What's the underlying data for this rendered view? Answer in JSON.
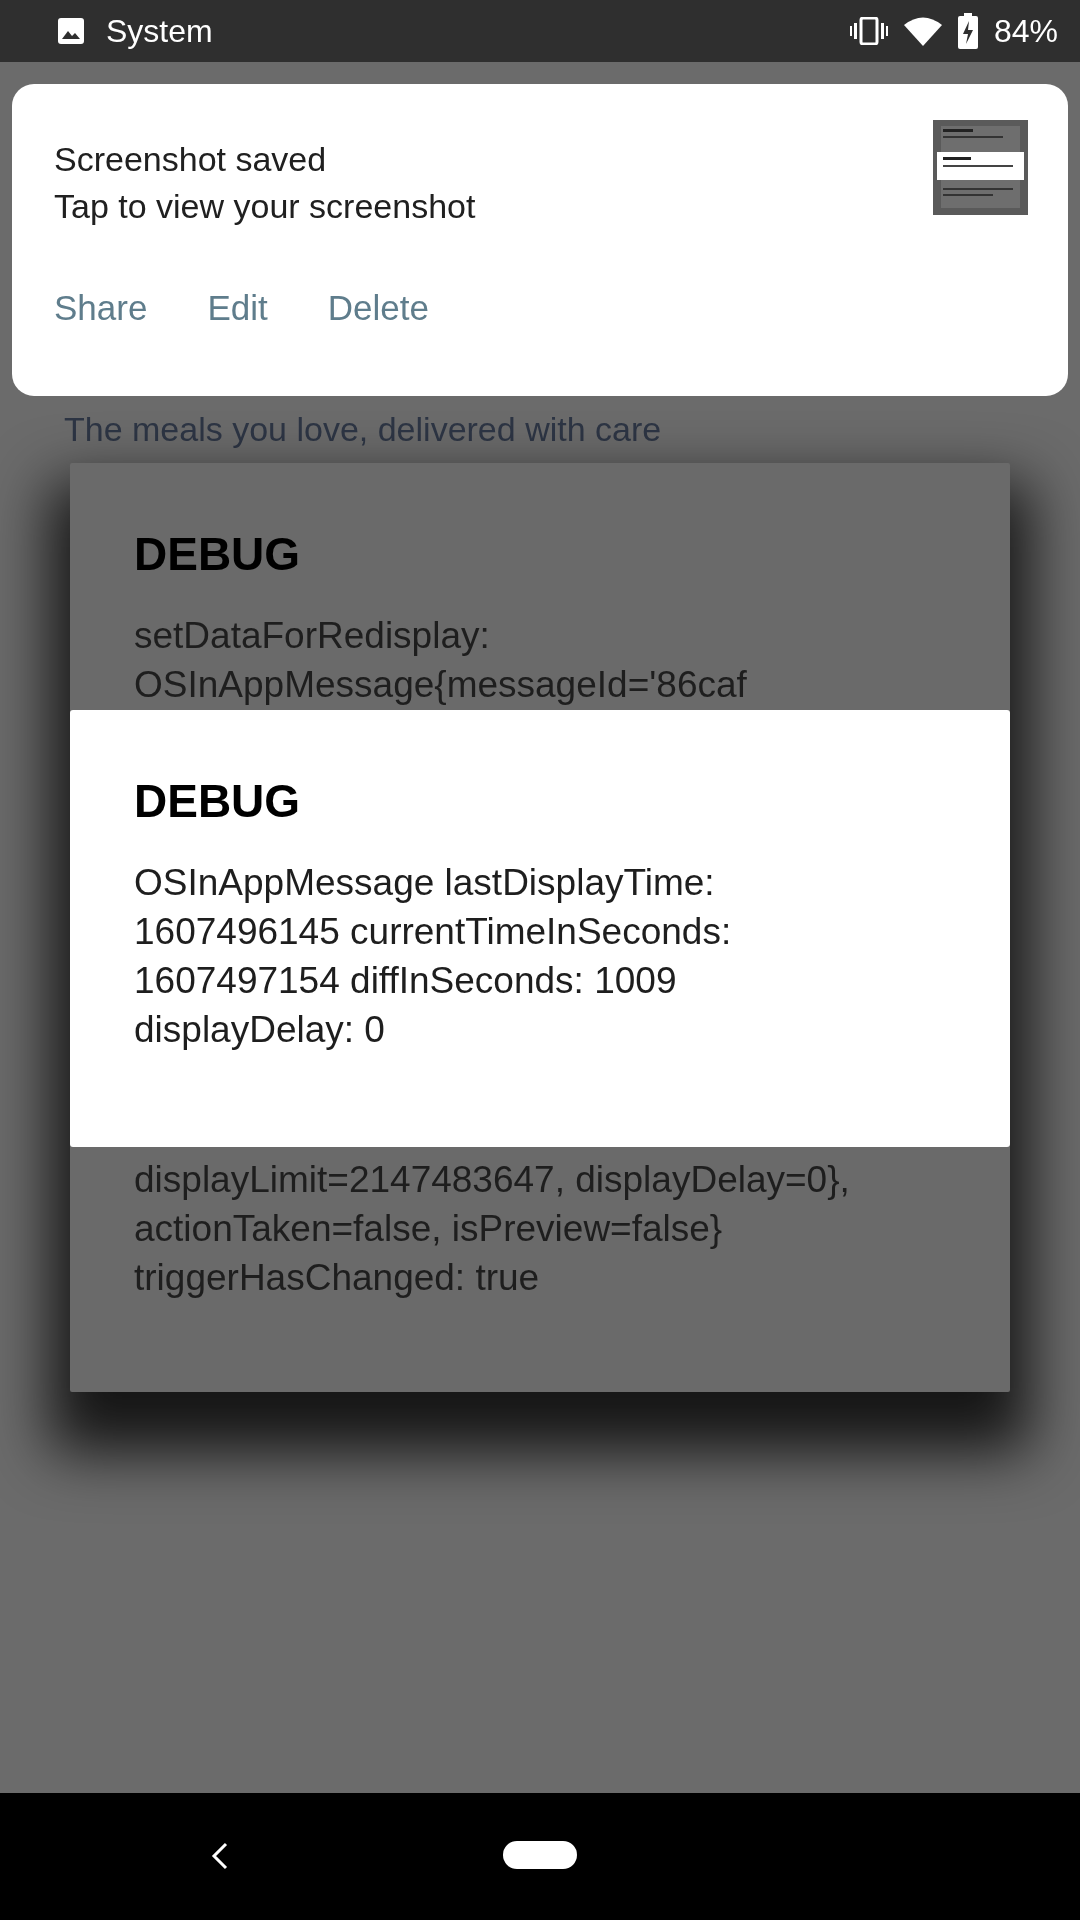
{
  "status_bar": {
    "app_label": "System",
    "battery": "84%"
  },
  "notification": {
    "title": "Screenshot saved",
    "text": "Tap to view your screenshot",
    "actions": [
      "Share",
      "Edit",
      "Delete"
    ]
  },
  "background_app": {
    "tagline": "The meals you love, delivered with care"
  },
  "back_dialog": {
    "title": "DEBUG",
    "message_start": "setDataForRedisplay:\nOSInAppMessage{messageId='86caf",
    "message_end": "displayLimit=2147483647, displayDelay=0},\nactionTaken=false, isPreview=false}\ntriggerHasChanged: true"
  },
  "front_dialog": {
    "title": "DEBUG",
    "message": "OSInAppMessage lastDisplayTime:\n1607496145 currentTimeInSeconds:\n1607497154 diffInSeconds: 1009\ndisplayDelay: 0"
  }
}
